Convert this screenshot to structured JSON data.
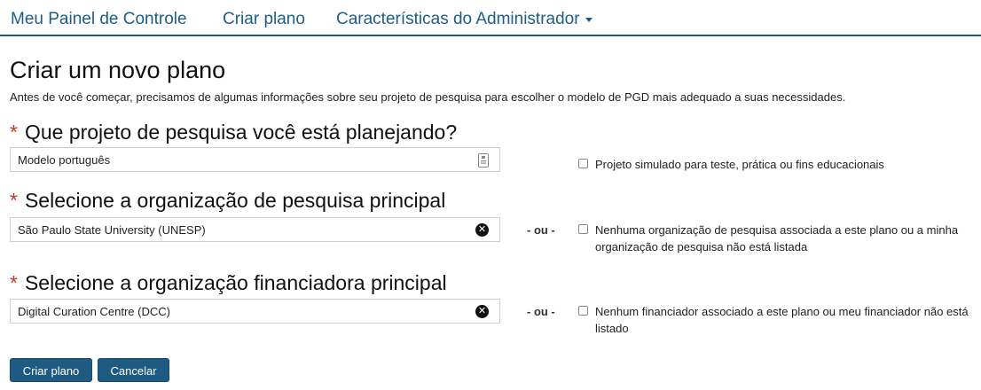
{
  "nav": {
    "items": [
      {
        "label": "Meu Painel de Controle"
      },
      {
        "label": "Criar plano"
      },
      {
        "label": "Características do Administrador"
      }
    ]
  },
  "page": {
    "title": "Criar um novo plano",
    "intro": "Antes de você começar, precisamos de algumas informações sobre seu projeto de pesquisa para escolher o modelo de PGD mais adequado a suas necessidades."
  },
  "form": {
    "required_mark": "*",
    "or_text": "- ou -",
    "project": {
      "label": "Que projeto de pesquisa você está planejando?",
      "value": "Modelo português",
      "checkbox_label": "Projeto simulado para teste, prática ou fins educacionais"
    },
    "research_org": {
      "label": "Selecione a organização de pesquisa principal",
      "value": "São Paulo State University (UNESP)",
      "checkbox_label": "Nenhuma organização de pesquisa associada a este plano ou a minha organização de pesquisa não está listada"
    },
    "funder": {
      "label": "Selecione a organização financiadora principal",
      "value": "Digital Curation Centre (DCC)",
      "checkbox_label": "Nenhum financiador associado a este plano ou meu financiador não está listado"
    },
    "submit_label": "Criar plano",
    "cancel_label": "Cancelar",
    "clear_glyph": "✕"
  },
  "icons": {
    "dropdown": "caret-down-icon",
    "field_list": "contact-card-icon",
    "clear": "clear-x-icon"
  },
  "colors": {
    "brand": "#1d5d86",
    "button": "#1d5b83",
    "required": "#c0392b"
  }
}
